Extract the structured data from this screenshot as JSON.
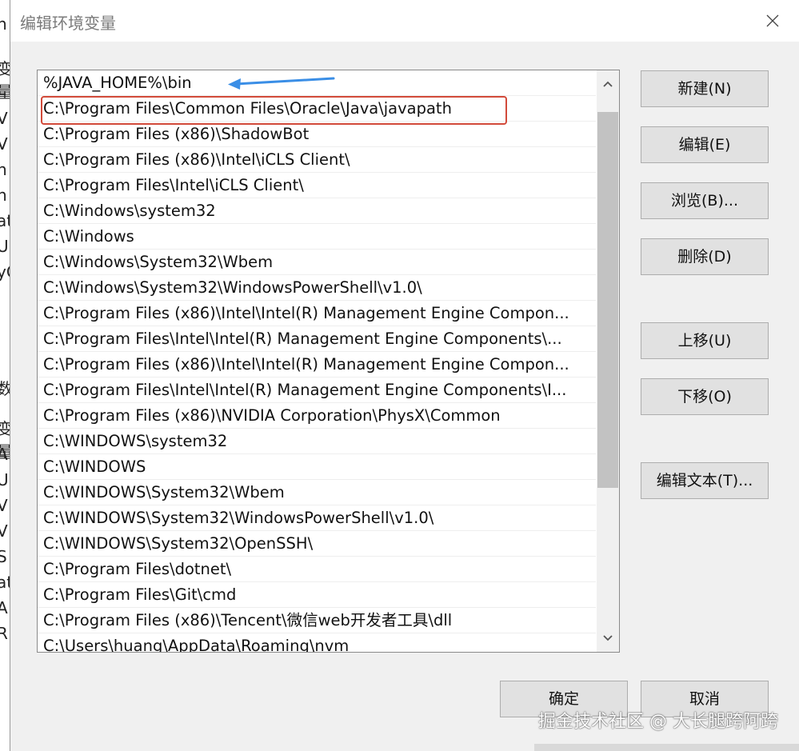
{
  "background_window": {
    "fragments": [
      "n",
      "变量",
      "L",
      "V",
      "V",
      "n",
      "n",
      "at",
      "U",
      "yC",
      "数",
      "变量",
      "A",
      "U",
      "V",
      "V",
      "S",
      "at",
      "A",
      "R"
    ]
  },
  "dialog": {
    "title": "编辑环境变量"
  },
  "list": {
    "items": [
      "%JAVA_HOME%\\bin",
      "C:\\Program Files\\Common Files\\Oracle\\Java\\javapath",
      "C:\\Program Files (x86)\\ShadowBot",
      "C:\\Program Files (x86)\\Intel\\iCLS Client\\",
      "C:\\Program Files\\Intel\\iCLS Client\\",
      "C:\\Windows\\system32",
      "C:\\Windows",
      "C:\\Windows\\System32\\Wbem",
      "C:\\Windows\\System32\\WindowsPowerShell\\v1.0\\",
      "C:\\Program Files (x86)\\Intel\\Intel(R) Management Engine Compon...",
      "C:\\Program Files\\Intel\\Intel(R) Management Engine Components\\...",
      "C:\\Program Files (x86)\\Intel\\Intel(R) Management Engine Compon...",
      "C:\\Program Files\\Intel\\Intel(R) Management Engine Components\\I...",
      "C:\\Program Files (x86)\\NVIDIA Corporation\\PhysX\\Common",
      "C:\\WINDOWS\\system32",
      "C:\\WINDOWS",
      "C:\\WINDOWS\\System32\\Wbem",
      "C:\\WINDOWS\\System32\\WindowsPowerShell\\v1.0\\",
      "C:\\WINDOWS\\System32\\OpenSSH\\",
      "C:\\Program Files\\dotnet\\",
      "C:\\Program Files\\Git\\cmd",
      "C:\\Program Files (x86)\\Tencent\\微信web开发者工具\\dll",
      "C:\\Users\\huang\\AppData\\Roaming\\nvm"
    ]
  },
  "buttons": {
    "new": "新建(N)",
    "edit": "编辑(E)",
    "browse": "浏览(B)...",
    "delete": "删除(D)",
    "move_up": "上移(U)",
    "move_down": "下移(O)",
    "edit_text": "编辑文本(T)...",
    "ok": "确定",
    "cancel": "取消"
  },
  "watermark": "掘金技术社区 @ 大长腿跨阿跨",
  "colors": {
    "highlight_border": "#d24a3a",
    "annotation_arrow": "#3a8ee6"
  },
  "icons": {
    "close": "close-icon",
    "scroll_up": "chevron-up-icon",
    "scroll_down": "chevron-down-icon",
    "annotation": "arrow-left-icon"
  }
}
